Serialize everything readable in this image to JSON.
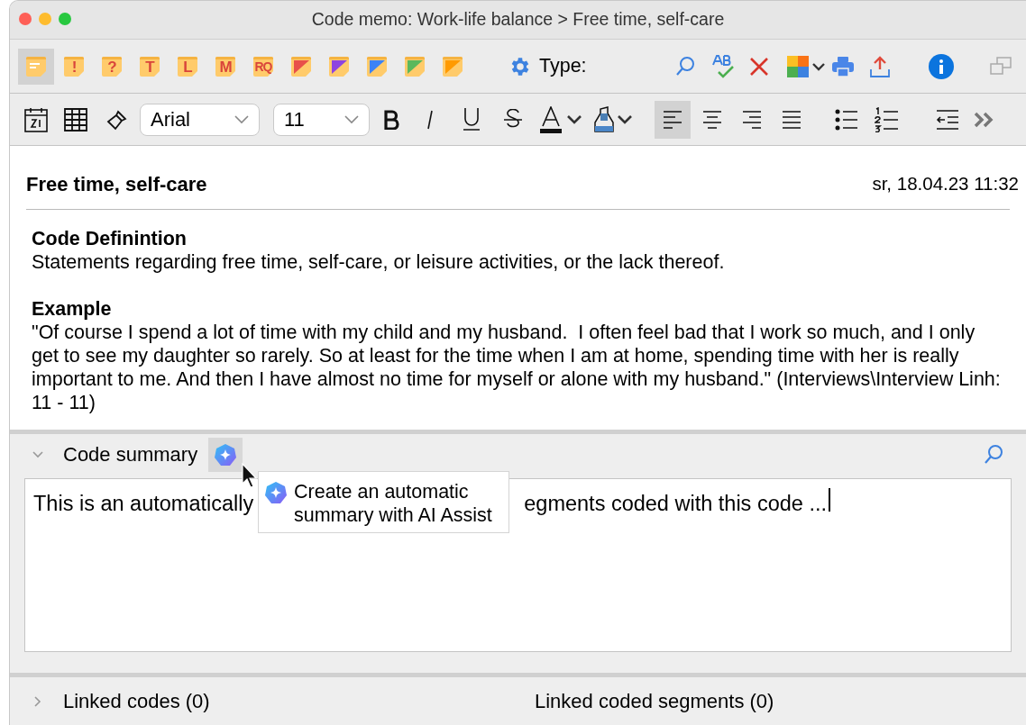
{
  "window": {
    "title": "Code memo: Work-life balance > Free time, self-care"
  },
  "memo_types": [
    {
      "kind": "lines",
      "selected": true
    },
    {
      "kind": "letter",
      "label": "!",
      "selected": false
    },
    {
      "kind": "letter",
      "label": "?",
      "selected": false
    },
    {
      "kind": "letter",
      "label": "T",
      "selected": false
    },
    {
      "kind": "letter",
      "label": "L",
      "selected": false
    },
    {
      "kind": "letter",
      "label": "M",
      "selected": false
    },
    {
      "kind": "letter",
      "label": "RQ",
      "selected": false
    },
    {
      "kind": "corner",
      "color": "#e8504a",
      "selected": false
    },
    {
      "kind": "corner",
      "color": "#8e44e0",
      "selected": false
    },
    {
      "kind": "corner",
      "color": "#3b82f6",
      "selected": false
    },
    {
      "kind": "corner",
      "color": "#5cb85c",
      "selected": false
    },
    {
      "kind": "corner",
      "color": "#ff9a00",
      "selected": false
    }
  ],
  "type_label": "Type:",
  "format": {
    "font": "Arial",
    "size": "11",
    "alignments": [
      {
        "kind": "left",
        "selected": true
      },
      {
        "kind": "center",
        "selected": false
      },
      {
        "kind": "right",
        "selected": false
      },
      {
        "kind": "justify",
        "selected": false
      }
    ]
  },
  "memo": {
    "title": "Free time, self-care",
    "date": "sr, 18.04.23 11:32",
    "sections": [
      {
        "heading": "Code Definintion",
        "text": "Statements regarding free time, self-care, or leisure activities, or the lack thereof."
      },
      {
        "heading": "Example",
        "text": "\"Of course I spend a lot of time with my child and my husband.  I often feel bad that I work so much, and I only get to see my daughter so rarely. So at least for the time when I am at home, spending time with her is really important to me. And then I have almost no time for myself or alone with my husband.\" (Interviews\\Interview Linh: 11 - 11)"
      }
    ]
  },
  "summary": {
    "label": "Code summary",
    "expanded": true,
    "text_before": "This is an automatically",
    "text_after": "egments coded with this code ...",
    "tooltip": "Create an automatic summary with AI Assist"
  },
  "linked": {
    "expanded": false,
    "codes": "Linked codes (0)",
    "segments": "Linked coded segments (0)"
  }
}
